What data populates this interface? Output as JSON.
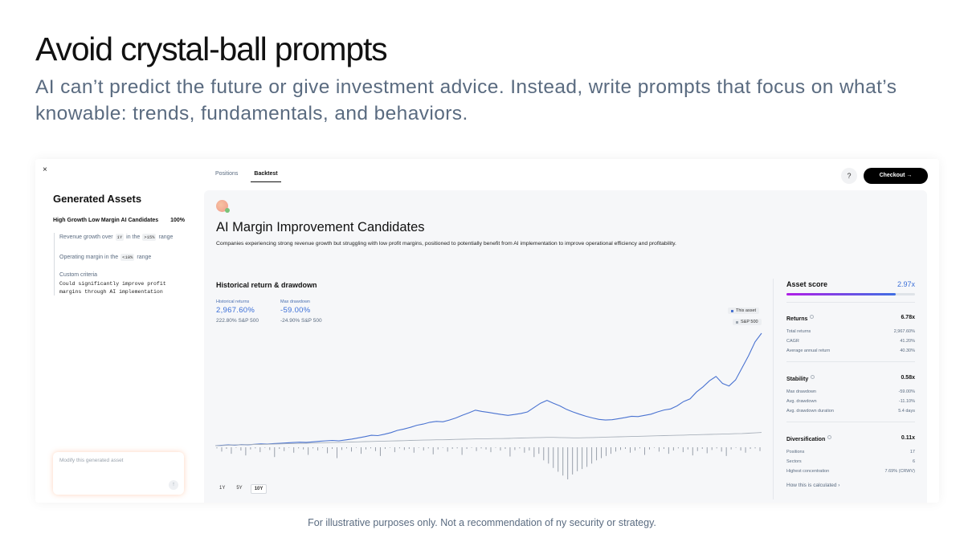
{
  "slide": {
    "title": "Avoid crystal-ball prompts",
    "subtitle": "AI can’t predict the future or give investment advice. Instead, write prompts that focus on what’s knowable: trends, fundamentals, and behaviors.",
    "footnote": "For illustrative purposes only. Not a recommendation of ny security or strategy."
  },
  "app": {
    "close_label": "×",
    "tabs": [
      {
        "label": "Positions",
        "active": false
      },
      {
        "label": "Backtest",
        "active": true
      }
    ],
    "help_label": "?",
    "checkout_label": "Checkout →"
  },
  "left_panel": {
    "title": "Generated Assets",
    "strategy_name": "High Growth Low Margin AI Candidates",
    "strategy_pct": "100%",
    "criteria": [
      {
        "pre": "Revenue growth over",
        "chip1": "1Y",
        "mid": "in the",
        "chip2": ">15%",
        "post": "range"
      },
      {
        "pre": "Operating margin in the",
        "chip1": "<10%",
        "post": "range"
      }
    ],
    "custom_label": "Custom criteria",
    "custom_text_1": "Could significantly improve profit",
    "custom_text_2": "margins through AI implementation",
    "modify_placeholder": "Modify this generated asset",
    "send_icon": "↑"
  },
  "asset": {
    "title": "AI Margin Improvement Candidates",
    "description": "Companies experiencing strong revenue growth but struggling with low profit margins, positioned to potentially benefit from AI implementation to improve operational efficiency and profitability."
  },
  "chart": {
    "title": "Historical return & drawdown",
    "hist_label": "Historical returns",
    "hist_value": "2,967.60%",
    "hist_sub": "222.80% S&P 500",
    "dd_label": "Max drawdown",
    "dd_value": "-59.00%",
    "dd_sub": "-24.90% S&P 500",
    "legend_asset": "This asset",
    "legend_sp": "S&P 500",
    "asset_color": "#4a73d1",
    "sp_color": "#aab2bc",
    "ranges": [
      {
        "label": "1Y",
        "active": false
      },
      {
        "label": "5Y",
        "active": false
      },
      {
        "label": "10Y",
        "active": true
      }
    ]
  },
  "chart_data": {
    "type": "line",
    "series": [
      {
        "name": "This asset",
        "values": [
          0,
          2,
          4,
          3,
          6,
          5,
          8,
          10,
          9,
          12,
          14,
          16,
          18,
          20,
          19,
          22,
          25,
          28,
          30,
          28,
          33,
          38,
          45,
          52,
          60,
          58,
          66,
          75,
          88,
          96,
          106,
          118,
          125,
          135,
          140,
          138,
          148,
          160,
          176,
          190,
          205,
          198,
          192,
          186,
          180,
          175,
          180,
          186,
          195,
          220,
          245,
          262,
          245,
          230,
          210,
          195,
          182,
          170,
          160,
          152,
          148,
          150,
          156,
          162,
          170,
          168,
          175,
          182,
          195,
          206,
          212,
          230,
          255,
          270,
          310,
          340,
          375,
          400,
          360,
          345,
          380,
          450,
          520,
          600,
          650
        ]
      },
      {
        "name": "S&P 500",
        "values": [
          0,
          1,
          3,
          4,
          5,
          6,
          7,
          7,
          8,
          9,
          10,
          11,
          12,
          13,
          14,
          15,
          16,
          17,
          18,
          19,
          20,
          21,
          22,
          23,
          24,
          25,
          26,
          27,
          28,
          29,
          30,
          31,
          32,
          33,
          34,
          34,
          35,
          36,
          37,
          38,
          39,
          40,
          40,
          41,
          41,
          42,
          43,
          44,
          45,
          46,
          47,
          48,
          48,
          47,
          46,
          45,
          45,
          46,
          47,
          48,
          49,
          50,
          51,
          52,
          53,
          54,
          55,
          56,
          57,
          58,
          59,
          60,
          61,
          62,
          63,
          64,
          65,
          66,
          67,
          68,
          69,
          70,
          72,
          74,
          76
        ]
      }
    ],
    "drawdown_series": {
      "name": "Drawdown",
      "values": [
        -2,
        -8,
        -3,
        -12,
        -1,
        -6,
        -15,
        -4,
        -2,
        -9,
        -1,
        -5,
        -18,
        -3,
        -7,
        -1,
        -10,
        -2,
        -4,
        -14,
        -2,
        -6,
        -1,
        -11,
        -3,
        -20,
        -5,
        -2,
        -8,
        -1,
        -12,
        -4,
        -2,
        -7,
        -16,
        -3,
        -1,
        -9,
        -2,
        -5,
        -3,
        -10,
        -1,
        -6,
        -2,
        -13,
        -4,
        -1,
        -8,
        -3,
        -2,
        -14,
        -3,
        -1,
        -7,
        -2,
        -4,
        -9,
        -1,
        -6,
        -3,
        -17,
        -5,
        -2,
        -10,
        -6,
        -18,
        -12,
        -24,
        -30,
        -38,
        -45,
        -52,
        -59,
        -50,
        -44,
        -40,
        -36,
        -30,
        -24,
        -20,
        -16,
        -12,
        -8,
        -5,
        -3,
        -10,
        -6,
        -2,
        -14,
        -4,
        -1,
        -8,
        -3,
        -12,
        -6,
        -2,
        -9,
        -4,
        -15,
        -7,
        -3,
        -11,
        -5,
        -2,
        -8,
        -16,
        -4,
        -1,
        -6,
        -10,
        -3,
        -2,
        -7
      ]
    },
    "title": "Historical return & drawdown",
    "xlabel": "",
    "ylabel": ""
  },
  "score": {
    "label": "Asset score",
    "value": "2.97x",
    "fill_fraction": 0.85,
    "groups": [
      {
        "name": "Returns",
        "score": "6.78x",
        "rows": [
          {
            "k": "Total returns",
            "v": "2,967.60%"
          },
          {
            "k": "CAGR",
            "v": "41.20%"
          },
          {
            "k": "Average annual return",
            "v": "40.30%"
          }
        ]
      },
      {
        "name": "Stability",
        "score": "0.58x",
        "rows": [
          {
            "k": "Max drawdown",
            "v": "-59.00%"
          },
          {
            "k": "Avg. drawdown",
            "v": "-11.10%"
          },
          {
            "k": "Avg. drawdown duration",
            "v": "5.4 days"
          }
        ]
      },
      {
        "name": "Diversification",
        "score": "0.11x",
        "rows": [
          {
            "k": "Positions",
            "v": "17"
          },
          {
            "k": "Sectors",
            "v": "6"
          },
          {
            "k": "Highest concentration",
            "v": "7.69% (CRWV)"
          }
        ]
      }
    ],
    "calc_link": "How this is calculated ›"
  }
}
